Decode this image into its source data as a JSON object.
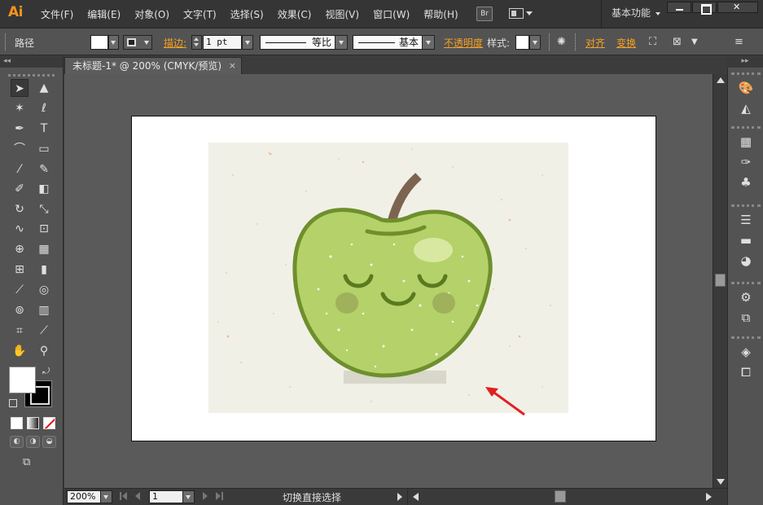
{
  "app": {
    "logo": "Ai",
    "menu": [
      "文件(F)",
      "编辑(E)",
      "对象(O)",
      "文字(T)",
      "选择(S)",
      "效果(C)",
      "视图(V)",
      "窗口(W)",
      "帮助(H)"
    ],
    "bridge_label": "Br",
    "workspace": "基本功能"
  },
  "control_bar": {
    "selection_type": "路径",
    "stroke_label": "描边:",
    "stroke_weight": "1 pt",
    "profile_label": "等比",
    "brush_label": "基本",
    "opacity_label": "不透明度",
    "style_label": "样式:",
    "align_label": "对齐",
    "transform_label": "变换"
  },
  "document": {
    "tab_title": "未标题-1* @ 200% (CMYK/预览)",
    "tab_close": "×"
  },
  "status": {
    "zoom": "200%",
    "page": "1",
    "tool_text": "切换直接选择"
  },
  "colors": {
    "accent_orange": "#f7941d",
    "apple_green": "#b5d16a",
    "apple_outline": "#6e8f2c",
    "stem_brown": "#7d6451",
    "art_bg": "#f1f0e7",
    "annotation_red": "#e02020"
  },
  "icons": {
    "toolbox": [
      "selection-tool",
      "direct-selection-tool",
      "magic-wand-tool",
      "lasso-tool",
      "pen-tool",
      "type-tool",
      "arc-tool",
      "rectangle-tool",
      "paintbrush-tool",
      "pencil-tool",
      "blob-brush-tool",
      "eraser-tool",
      "rotate-tool",
      "scale-tool",
      "warp-tool",
      "free-transform-tool",
      "shape-builder-tool",
      "perspective-grid-tool",
      "mesh-tool",
      "gradient-tool",
      "eyedropper-tool",
      "blend-tool",
      "symbol-sprayer-tool",
      "column-graph-tool",
      "artboard-tool",
      "slice-tool",
      "hand-tool",
      "zoom-tool"
    ],
    "right_dock": [
      "color-panel",
      "color-guide-panel",
      "swatches-panel",
      "brushes-panel",
      "symbols-panel",
      "stroke-panel",
      "gradient-panel",
      "transparency-panel",
      "appearance-panel",
      "graphic-styles-panel",
      "layers-panel",
      "artboards-panel"
    ]
  }
}
